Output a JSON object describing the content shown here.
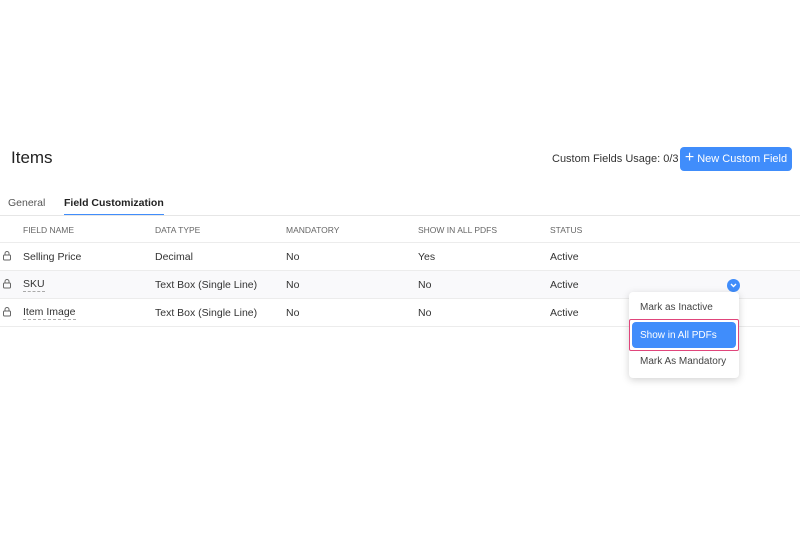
{
  "header": {
    "title": "Items",
    "usage": "Custom Fields Usage: 0/3",
    "new_button": "New Custom Field",
    "new_icon": "plus-icon"
  },
  "tabs": [
    {
      "label": "General",
      "active": false
    },
    {
      "label": "Field Customization",
      "active": true
    }
  ],
  "table": {
    "columns": [
      "FIELD NAME",
      "DATA TYPE",
      "MANDATORY",
      "SHOW IN ALL PDFS",
      "STATUS"
    ],
    "rows": [
      {
        "name": "Selling Price",
        "type": "Decimal",
        "mandatory": "No",
        "pdfs": "Yes",
        "status": "Active"
      },
      {
        "name": "SKU",
        "type": "Text Box (Single Line)",
        "mandatory": "No",
        "pdfs": "No",
        "status": "Active"
      },
      {
        "name": "Item Image",
        "type": "Text Box (Single Line)",
        "mandatory": "No",
        "pdfs": "No",
        "status": "Active"
      }
    ]
  },
  "menu": {
    "items": [
      "Mark as Inactive",
      "Show in All PDFs",
      "Mark As Mandatory"
    ],
    "highlighted": "Show in All PDFs"
  },
  "colors": {
    "accent": "#408dfb",
    "highlight_outline": "#e0457b"
  }
}
